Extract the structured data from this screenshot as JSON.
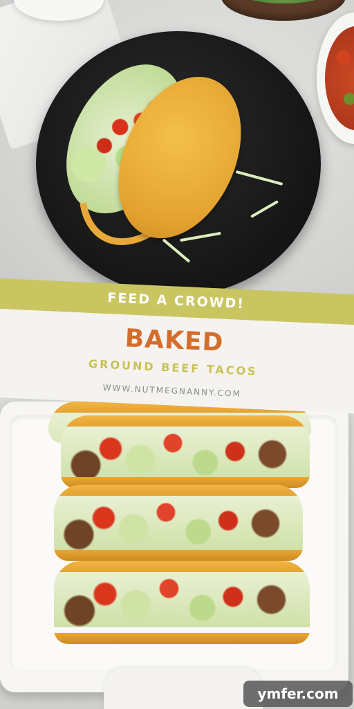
{
  "banner": {
    "tagline": "FEED A CROWD!",
    "title": "BAKED",
    "subtitle": "GROUND BEEF TACOS",
    "website": "WWW.NUTMEGNANNY.COM"
  },
  "watermark": {
    "text": "ymfer.com"
  },
  "colors": {
    "banner_green": "#c9c661",
    "banner_white": "#f5f3ef",
    "title_orange": "#d46d2c",
    "subtitle_green": "#c8c256",
    "url_gray": "#8b8b8b",
    "taco_shell": "#e9a93a",
    "plate_black": "#151515"
  }
}
